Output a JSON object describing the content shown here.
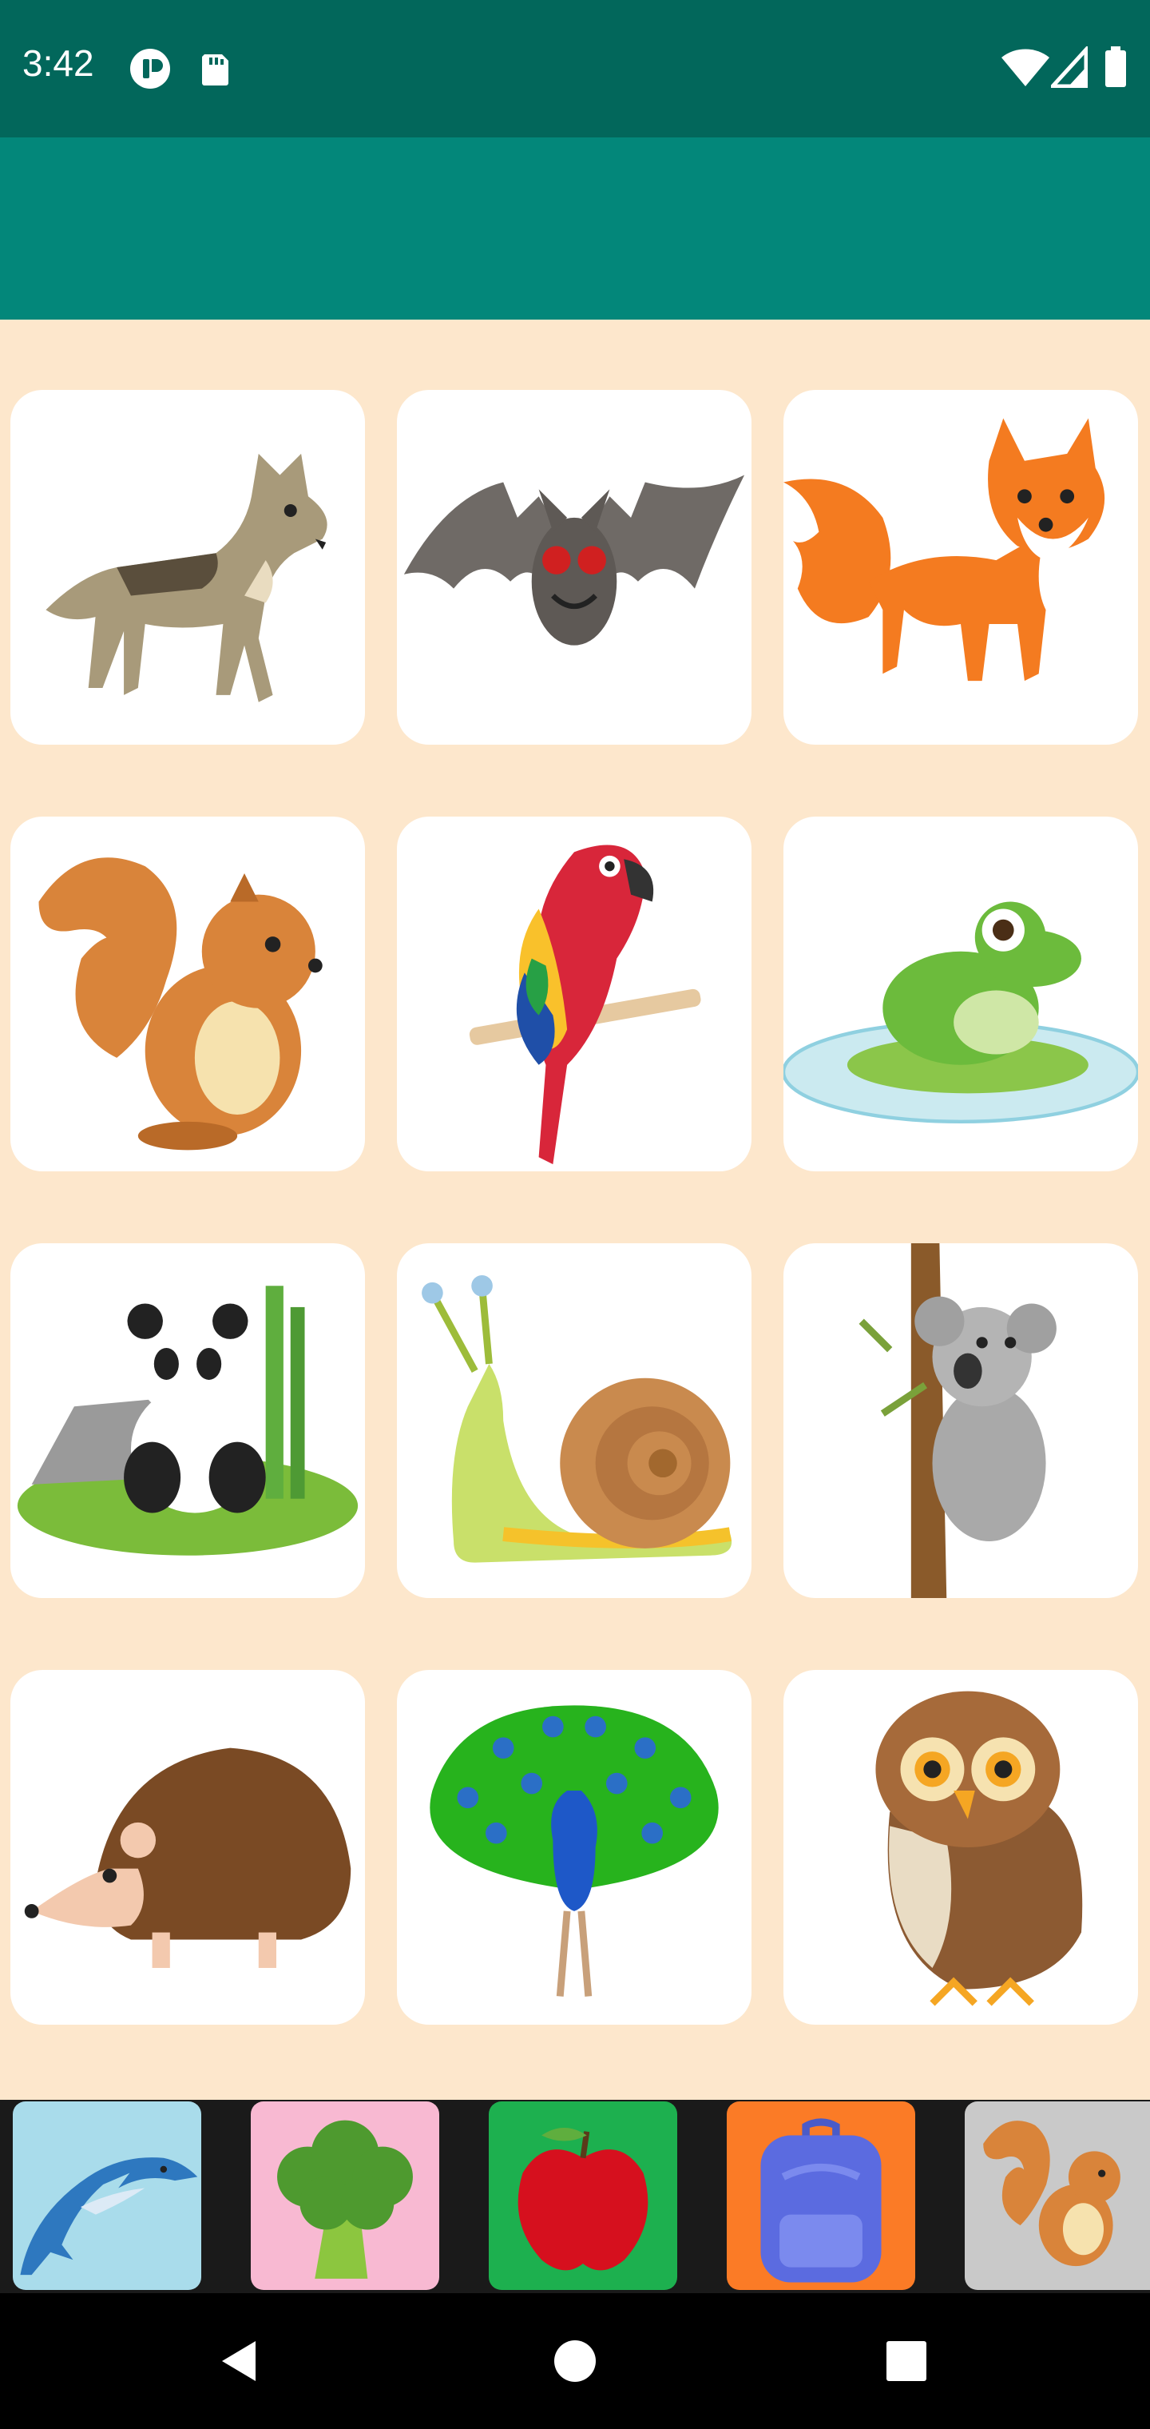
{
  "status_bar": {
    "time": "3:42",
    "left_icons": [
      "vpn-key-icon",
      "sd-card-icon"
    ],
    "right_icons": [
      "wifi-icon",
      "cell-signal-icon",
      "battery-icon"
    ],
    "background": "#02675B"
  },
  "app_bar": {
    "background": "#03877A"
  },
  "content": {
    "background": "#FDE7CC"
  },
  "animal_grid": [
    {
      "name": "wolf"
    },
    {
      "name": "bat"
    },
    {
      "name": "fox"
    },
    {
      "name": "squirrel"
    },
    {
      "name": "parrot"
    },
    {
      "name": "frog"
    },
    {
      "name": "panda"
    },
    {
      "name": "snail"
    },
    {
      "name": "koala"
    },
    {
      "name": "hedgehog"
    },
    {
      "name": "peacock"
    },
    {
      "name": "owl"
    }
  ],
  "category_strip": [
    {
      "name": "dolphin",
      "color": "#A9DCEB"
    },
    {
      "name": "broccoli",
      "color": "#F8B9D2"
    },
    {
      "name": "apple",
      "color": "#1DB04F"
    },
    {
      "name": "backpack",
      "color": "#FB7B26"
    },
    {
      "name": "squirrel",
      "color": "#C9C9C9"
    }
  ],
  "nav_bar": [
    "back-icon",
    "home-icon",
    "recents-icon"
  ]
}
